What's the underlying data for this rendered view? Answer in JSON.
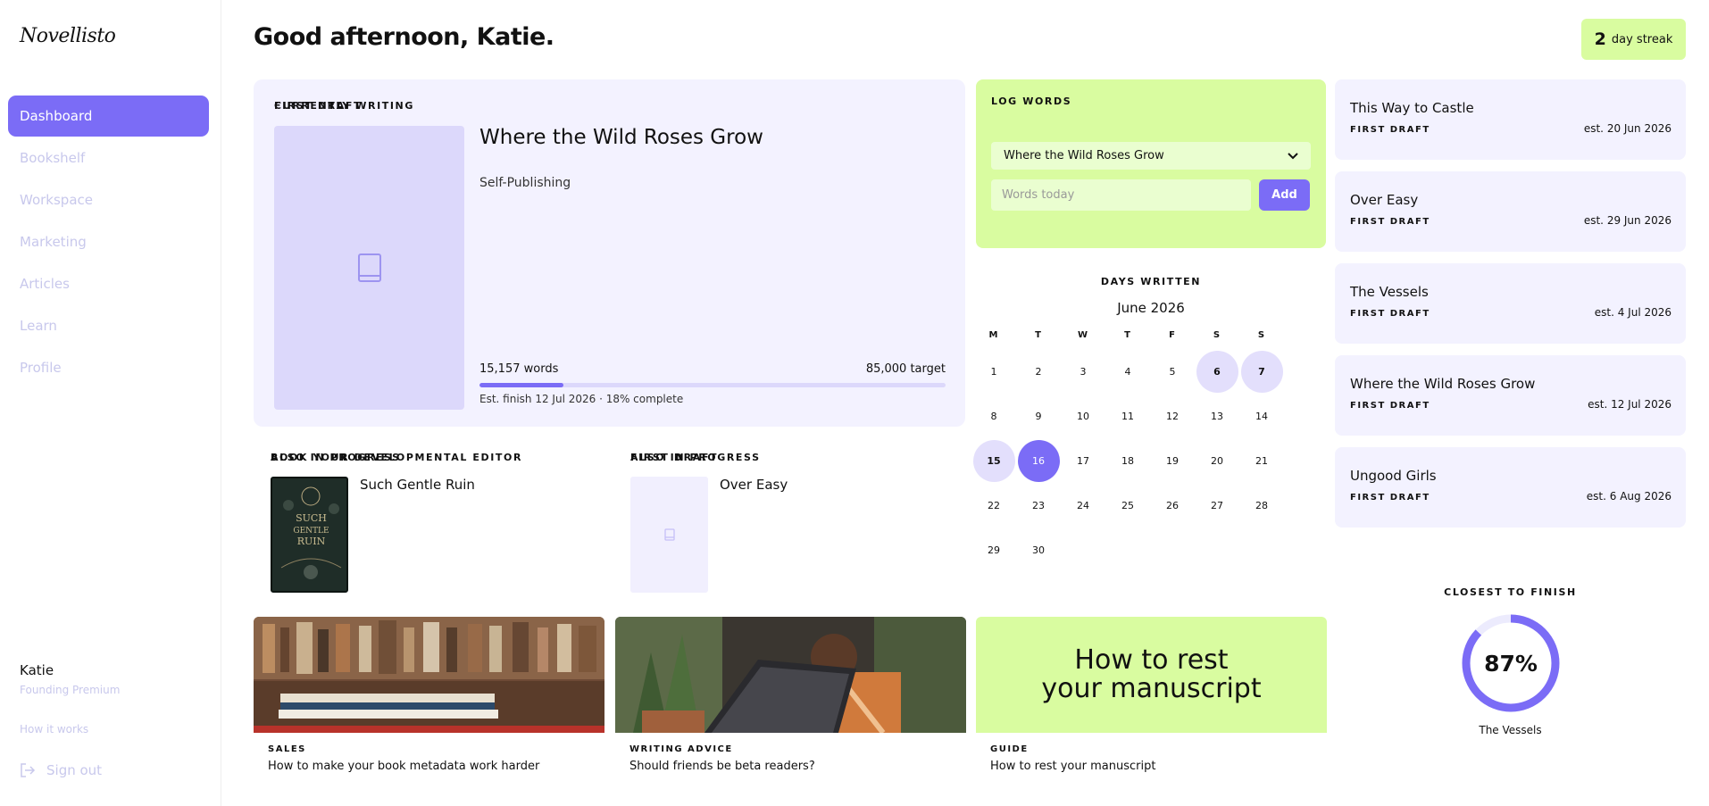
{
  "app": {
    "logo": "Novellisto"
  },
  "sidebar": {
    "items": [
      {
        "label": "Dashboard",
        "active": true
      },
      {
        "label": "Bookshelf"
      },
      {
        "label": "Workspace"
      },
      {
        "label": "Marketing"
      },
      {
        "label": "Articles"
      },
      {
        "label": "Learn"
      },
      {
        "label": "Profile"
      }
    ],
    "user": {
      "name": "Katie",
      "plan": "Founding Premium"
    },
    "how_it_works": "How it works",
    "sign_out": "Sign out"
  },
  "header": {
    "greeting": "Good afternoon, Katie.",
    "streak_count": "2",
    "streak_label": "day streak"
  },
  "currently_writing": {
    "section_label": "CURRENTLY WRITING",
    "title": "Where the Wild Roses Grow",
    "status": "FIRST DRAFT",
    "publishing": "Self-Publishing",
    "words": "15,157 words",
    "target": "85,000 target",
    "progress_fraction": 0.18,
    "estimate": "Est. finish 12 Jul 2026 · 18% complete"
  },
  "also_in_progress": [
    {
      "section_label": "ALSO IN PROGRESS",
      "title": "Such Gentle Ruin",
      "status": "BOOK YOUR DEVELOPMENTAL EDITOR",
      "cover_text": "SUCH GENTLE RUIN"
    },
    {
      "section_label": "ALSO IN PROGRESS",
      "title": "Over Easy",
      "status": "FIRST DRAFT"
    }
  ],
  "articles": [
    {
      "category": "SALES",
      "title": "How to make your book metadata work harder"
    },
    {
      "category": "WRITING ADVICE",
      "title": "Should friends be beta readers?"
    },
    {
      "category": "GUIDE",
      "title": "How to rest your manuscript",
      "image_text_line1": "How to rest",
      "image_text_line2": "your manuscript"
    }
  ],
  "log_words": {
    "section_label": "LOG WORDS",
    "selected_book": "Where the Wild Roses Grow",
    "input_placeholder": "Words today",
    "add_label": "Add"
  },
  "calendar": {
    "section_label": "DAYS WRITTEN",
    "month": "June 2026",
    "weekdays": [
      "M",
      "T",
      "W",
      "T",
      "F",
      "S",
      "S"
    ],
    "days": [
      "1",
      "2",
      "3",
      "4",
      "5",
      "6",
      "7",
      "8",
      "9",
      "10",
      "11",
      "12",
      "13",
      "14",
      "15",
      "16",
      "17",
      "18",
      "19",
      "20",
      "21",
      "22",
      "23",
      "24",
      "25",
      "26",
      "27",
      "28",
      "29",
      "30"
    ],
    "written_days": [
      "6",
      "7",
      "15"
    ],
    "today": "16"
  },
  "upcoming": [
    {
      "title": "This Way to Castle",
      "status": "FIRST DRAFT",
      "estimate": "est. 20 Jun 2026"
    },
    {
      "title": "Over Easy",
      "status": "FIRST DRAFT",
      "estimate": "est. 29 Jun 2026"
    },
    {
      "title": "The Vessels",
      "status": "FIRST DRAFT",
      "estimate": "est. 4 Jul 2026"
    },
    {
      "title": "Where the Wild Roses Grow",
      "status": "FIRST DRAFT",
      "estimate": "est. 12 Jul 2026"
    },
    {
      "title": "Ungood Girls",
      "status": "FIRST DRAFT",
      "estimate": "est. 6 Aug 2026"
    }
  ],
  "closest": {
    "section_label": "CLOSEST TO FINISH",
    "percent": "87%",
    "fraction": 0.87,
    "book": "The Vessels"
  },
  "colors": {
    "accent": "#7b6cf6",
    "lavender": "#f3f2ff",
    "lime": "#d9fca0",
    "muted_nav": "#c8c8ec"
  },
  "icons": {
    "cover_placeholder": "book-icon",
    "select_chevron": "chevron-down-icon",
    "sign_out": "sign-out-icon"
  }
}
